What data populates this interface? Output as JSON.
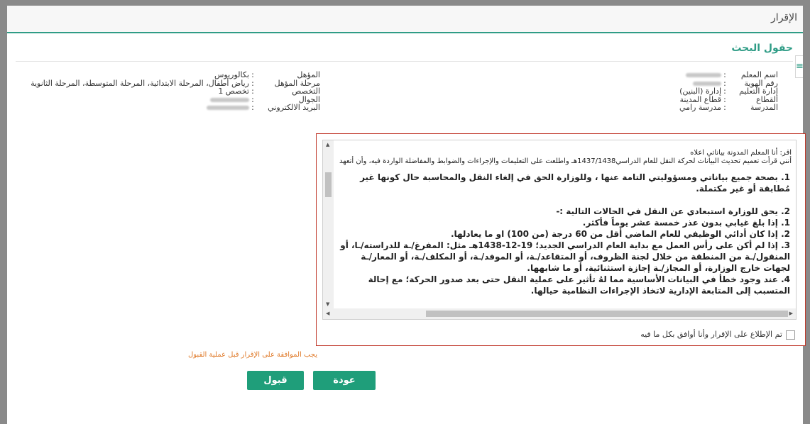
{
  "header": {
    "title": "الإقرار"
  },
  "section": {
    "title": "حقول البحث",
    "side_icon": "≡"
  },
  "info_right": [
    {
      "label": "اسم المعلم",
      "value": ""
    },
    {
      "label": "رقم الهوية",
      "value": ""
    },
    {
      "label": "إدارة التعليم",
      "value": "إدارة (البنين)"
    },
    {
      "label": "القطاع",
      "value": "قطاع المدينة"
    },
    {
      "label": "المدرسة",
      "value": "مدرسة رامي"
    }
  ],
  "info_left": [
    {
      "label": "المؤهل",
      "value": "بكالوريوس"
    },
    {
      "label": "مرحلة المؤهل",
      "value": "رياض أطفال، المرحلة الابتدائية، المرحلة المتوسطة، المرحلة الثانوية"
    },
    {
      "label": "التخصص",
      "value": "تخصص 1"
    },
    {
      "label": "الجوال",
      "value": ""
    },
    {
      "label": "البريد الالكتروني",
      "value": ""
    }
  ],
  "declaration": {
    "intro1": "اقر: أنا المعلم المدونة بياناتي اعلاه",
    "intro2": "أنني قرأت تعميم تحديث البيانات لحركة النقل للعام الدراسي1437/1438هـ واطلعت على التعليمات والإجراءات والضوابط والمفاضلة الواردة فيه، وأن أتعهد",
    "p1": "1. بصحة جميع بياناتي ومسؤوليتي التامة عنها ، وللوزارة الحق في إلغاء النقل والمحاسبة حال كونها غير مُطابقة أو غير مكتملة.",
    "p2": "2. يحق للوزارة استبعادي عن النقل في الحالات التالية :-",
    "items": [
      "1. إذا بلغ غيابي بدون عذر خمسة عشر يوماً فأكثر.",
      "2. إذا كان أدائي الوظيفي للعام الماضي أقل من 60 درجة (من 100) او ما يعادلها.",
      "3. إذا لم أكن على رأس العمل مع بداية العام الدراسي الجديد؛ 19-12-1438هـ مثل: المفرغ/ـة للدراسته/ـا، أو المنقول/ـة من المنطقة من خلال لجنة الظروف، أو المتقاعد/ـة، أو الموفد/ـة، أو المكلف/ـة، أو المعار/ـة لجهات خارج الوزارة، أو المجاز/ـة إجازة استثنائية، أو ما شابهها.",
      "4. عند وجود خطأ في البيانات الأساسية مما لهُ تأثير على عملية النقل حتى بعد صدور الحركة؛ مع إحالة المتسبب إلى المتابعة الإدارية لاتخاذ الإجراءات النظامية حيالها."
    ]
  },
  "agree_label": "تم الإطلاع على الإقرار وأنا أوافق بكل ما فيه",
  "warning": "يجب الموافقة على الإقرار قبل عملية القبول",
  "buttons": {
    "back": "عودة",
    "accept": "قبول"
  },
  "colors": {
    "accent": "#2f9c86",
    "button": "#1f9e7a",
    "warning": "#e07b2b",
    "border": "#c0392b"
  }
}
